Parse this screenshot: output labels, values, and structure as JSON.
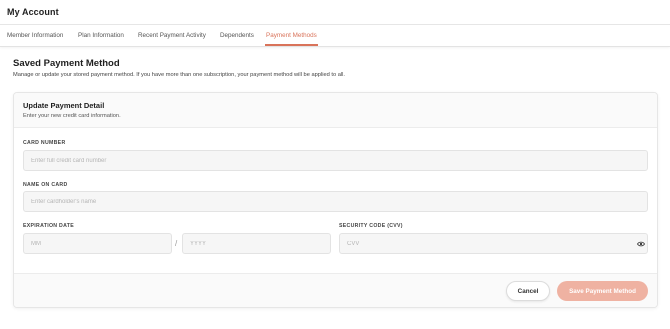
{
  "header": {
    "title": "My Account"
  },
  "tabs": [
    {
      "label": "Member Information",
      "active": false
    },
    {
      "label": "Plan Information",
      "active": false
    },
    {
      "label": "Recent Payment Activity",
      "active": false
    },
    {
      "label": "Dependents",
      "active": false
    },
    {
      "label": "Payment Methods",
      "active": true
    }
  ],
  "section": {
    "title": "Saved Payment Method",
    "description": "Manage or update your stored payment method. If you have more than one subscription, your payment method will be applied to all."
  },
  "card": {
    "title": "Update Payment Detail",
    "subtitle": "Enter your new credit card information.",
    "card_number": {
      "label": "CARD NUMBER",
      "placeholder": "Enter full credit card number",
      "value": ""
    },
    "name_on_card": {
      "label": "NAME ON CARD",
      "placeholder": "Enter cardholder's name",
      "value": ""
    },
    "expiration": {
      "label": "EXPIRATION DATE",
      "separator": "/",
      "month_placeholder": "MM",
      "year_placeholder": "YYYY"
    },
    "cvv": {
      "label": "SECURITY CODE (CVV)",
      "placeholder": "CVV",
      "value": "",
      "toggle_icon": "eye-icon"
    }
  },
  "footer": {
    "cancel_label": "Cancel",
    "save_label": "Save Payment Method"
  },
  "colors": {
    "accent": "#d9735a",
    "save_button_disabled": "#efb2a2"
  }
}
